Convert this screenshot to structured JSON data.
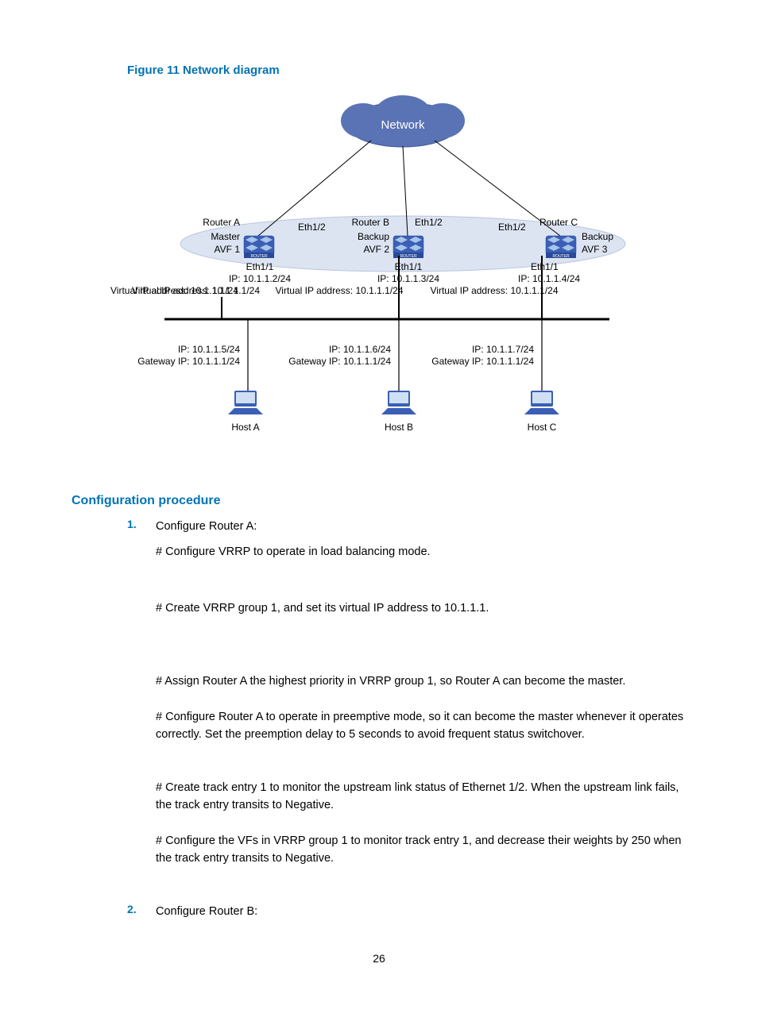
{
  "figure_title": "Figure 11 Network diagram",
  "diagram": {
    "network_label": "Network",
    "routers": [
      {
        "name": "Router A",
        "eth_up": "Eth1/2",
        "role1": "Master",
        "role2": "AVF 1",
        "eth_down": "Eth1/1",
        "ip": "IP: 10.1.1.2/24",
        "vip": "Virtual IP address: 10.1.1.1/24"
      },
      {
        "name": "Router B",
        "eth_up": "Eth1/2",
        "role1": "Backup",
        "role2": "AVF 2",
        "eth_down": "Eth1/1",
        "ip": "IP: 10.1.1.3/24",
        "vip": "Virtual IP address: 10.1.1.1/24"
      },
      {
        "name": "Router C",
        "eth_up": "Eth1/2",
        "role1": "Backup",
        "role2": "AVF 3",
        "eth_down": "Eth1/1",
        "ip": "IP: 10.1.1.4/24",
        "vip": "Virtual IP address: 10.1.1.1/24"
      }
    ],
    "hosts": [
      {
        "name": "Host A",
        "ip": "IP: 10.1.1.5/24",
        "gw": "Gateway IP: 10.1.1.1/24"
      },
      {
        "name": "Host B",
        "ip": "IP: 10.1.1.6/24",
        "gw": "Gateway IP: 10.1.1.1/24"
      },
      {
        "name": "Host C",
        "ip": "IP: 10.1.1.7/24",
        "gw": "Gateway IP: 10.1.1.1/24"
      }
    ]
  },
  "section_heading": "Configuration procedure",
  "steps": {
    "s1_num": "1.",
    "s1_title": "Configure Router A:",
    "s1_a": "# Configure VRRP to operate in load balancing mode.",
    "s1_b": "# Create VRRP group 1, and set its virtual IP address to 10.1.1.1.",
    "s1_c": "# Assign Router A the highest priority in VRRP group 1, so Router A can become the master.",
    "s1_d": "# Configure Router A to operate in preemptive mode, so it can become the master whenever it operates correctly. Set the preemption delay to 5 seconds to avoid frequent status switchover.",
    "s1_e": "# Create track entry 1 to monitor the upstream link status of Ethernet 1/2. When the upstream link fails, the track entry transits to Negative.",
    "s1_f": "# Configure the VFs in VRRP group 1 to monitor track entry 1, and decrease their weights by 250 when the track entry transits to Negative.",
    "s2_num": "2.",
    "s2_title": "Configure Router B:"
  },
  "page_number": "26"
}
